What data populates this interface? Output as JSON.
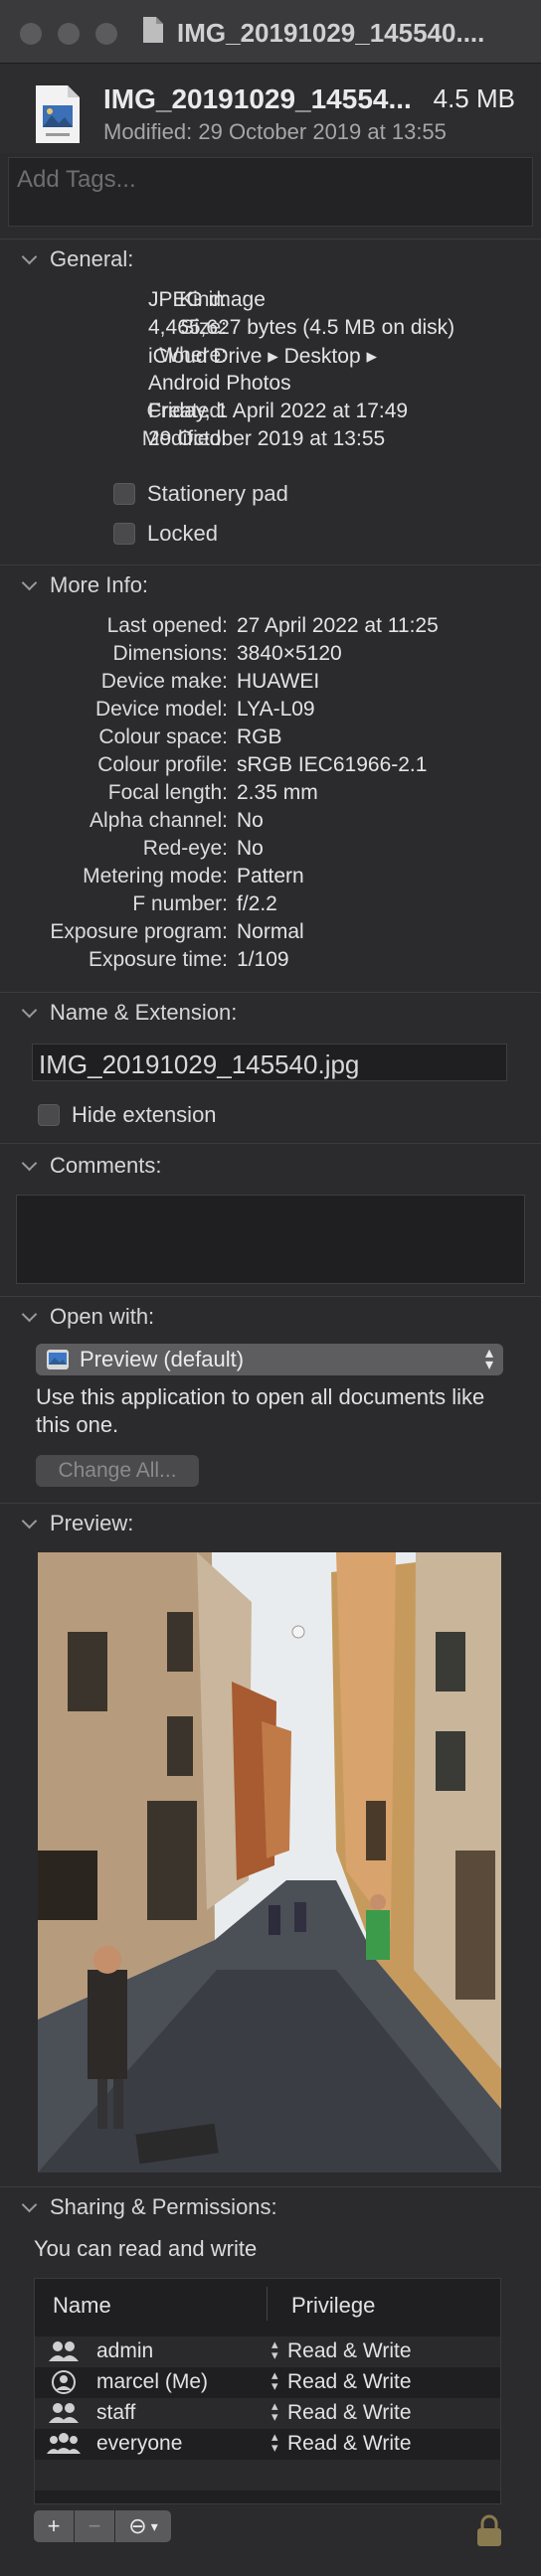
{
  "window": {
    "title": "IMG_20191029_145540...."
  },
  "header": {
    "file_name": "IMG_20191029_14554...",
    "file_size": "4.5 MB",
    "modified": "Modified: 29 October 2019 at 13:55",
    "tags_placeholder": "Add Tags..."
  },
  "general": {
    "title": "General:",
    "rows": [
      {
        "k": "Kind:",
        "v": "JPEG image"
      },
      {
        "k": "Size:",
        "v": "4,465,627 bytes (4.5 MB on disk)"
      },
      {
        "k": "Where:",
        "v": "iCloud Drive ▸ Desktop ▸"
      },
      {
        "k": "",
        "v": "Android Photos"
      },
      {
        "k": "Created:",
        "v": "Friday, 1 April 2022 at 17:49"
      },
      {
        "k": "Modified:",
        "v": "29 October 2019 at 13:55"
      }
    ],
    "stationery_label": "Stationery pad",
    "locked_label": "Locked"
  },
  "more_info": {
    "title": "More Info:",
    "rows": [
      {
        "k": "Last opened:",
        "v": "27 April 2022 at 11:25"
      },
      {
        "k": "Dimensions:",
        "v": "3840×5120"
      },
      {
        "k": "Device make:",
        "v": "HUAWEI"
      },
      {
        "k": "Device model:",
        "v": "LYA-L09"
      },
      {
        "k": "Colour space:",
        "v": "RGB"
      },
      {
        "k": "Colour profile:",
        "v": "sRGB IEC61966-2.1"
      },
      {
        "k": "Focal length:",
        "v": "2.35 mm"
      },
      {
        "k": "Alpha channel:",
        "v": "No"
      },
      {
        "k": "Red-eye:",
        "v": "No"
      },
      {
        "k": "Metering mode:",
        "v": "Pattern"
      },
      {
        "k": "F number:",
        "v": "f/2.2"
      },
      {
        "k": "Exposure program:",
        "v": "Normal"
      },
      {
        "k": "Exposure time:",
        "v": "1/109"
      }
    ]
  },
  "name_ext": {
    "title": "Name & Extension:",
    "value": "IMG_20191029_145540.jpg",
    "hide_label": "Hide extension"
  },
  "comments": {
    "title": "Comments:"
  },
  "open_with": {
    "title": "Open with:",
    "app": "Preview (default)",
    "desc": "Use this application to open all documents like this one.",
    "change_all": "Change All..."
  },
  "preview": {
    "title": "Preview:"
  },
  "sharing": {
    "title": "Sharing & Permissions:",
    "desc": "You can read and write",
    "col_name": "Name",
    "col_priv": "Privilege",
    "rows": [
      {
        "name": "admin",
        "priv": "Read & Write"
      },
      {
        "name": "marcel (Me)",
        "priv": "Read & Write"
      },
      {
        "name": "staff",
        "priv": "Read & Write"
      },
      {
        "name": "everyone",
        "priv": "Read & Write"
      }
    ],
    "add": "+",
    "remove": "−",
    "more": "⊖"
  }
}
